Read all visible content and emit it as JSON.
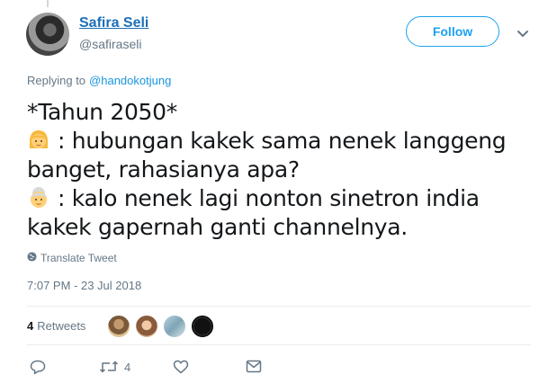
{
  "author": {
    "display_name": "Safira Seli",
    "handle": "@safiraseli"
  },
  "follow_button": {
    "label": "Follow"
  },
  "reply": {
    "prefix": "Replying to",
    "mention": "@handokotjung"
  },
  "tweet": {
    "line1": "*Tahun 2050*",
    "line2": ": hubungan kakek sama nenek langgeng",
    "line3": "banget, rahasianya apa?",
    "line4": ": kalo nenek lagi nonton sinetron india",
    "line5": "kakek gapernah ganti channelnya.",
    "emoji1": "girl-emoji",
    "emoji2": "older-woman-emoji"
  },
  "translate": {
    "label": "Translate Tweet"
  },
  "timestamp": "7:07 PM - 23 Jul 2018",
  "stats": {
    "retweet_count": "4",
    "retweet_label": "Retweets"
  },
  "actions": {
    "retweet_count": "4"
  },
  "colors": {
    "link": "#1b95e0",
    "follow": "#1da1f2",
    "muted": "#657786",
    "text": "#14171a",
    "divider": "#e6ecf0"
  }
}
